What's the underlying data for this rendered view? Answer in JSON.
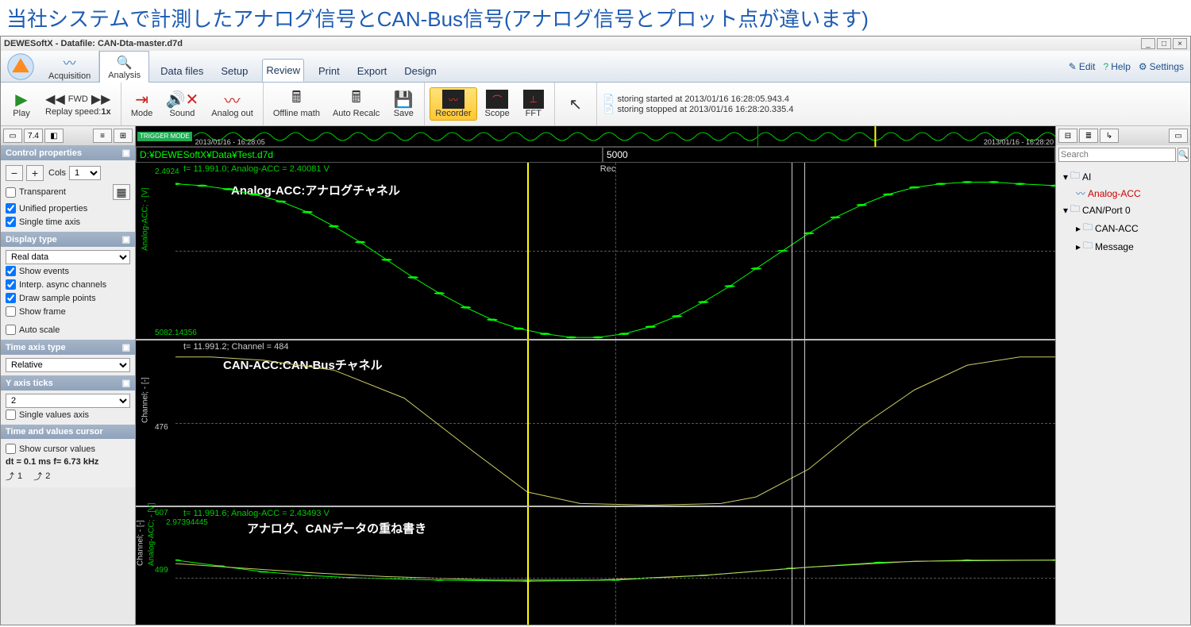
{
  "page_title": "当社システムで計測したアナログ信号とCAN-Bus信号(アナログ信号とプロット点が違います)",
  "titlebar": {
    "text": "DEWESoftX - Datafile: CAN-Dta-master.d7d"
  },
  "modes": {
    "acquisition": "Acquisition",
    "analysis": "Analysis"
  },
  "menu_tabs": [
    "Data files",
    "Setup",
    "Review",
    "Print",
    "Export",
    "Design"
  ],
  "menu_active": "Review",
  "top_links": {
    "edit": "Edit",
    "help": "Help",
    "settings": "Settings"
  },
  "toolbar": {
    "play": "Play",
    "fwd": "FWD",
    "replay": "Replay speed:",
    "replay_val": "1x",
    "mode": "Mode",
    "sound": "Sound",
    "analog_out": "Analog out",
    "offline_math": "Offline math",
    "auto_recalc": "Auto Recalc",
    "save": "Save",
    "recorder": "Recorder",
    "scope": "Scope",
    "fft": "FFT"
  },
  "status": {
    "line1": "storing started at 2013/01/16 16:28:05.943.4",
    "line2": "storing stopped at 2013/01/16 16:28:20.335.4"
  },
  "trigger": {
    "badge": "TRIGGER MODE",
    "t_left": "2013/01/16 - 16:28:05",
    "t_right": "2013/01/16 - 16:28:20"
  },
  "path_row": {
    "path": "D:¥DEWESoftX¥Data¥Test.d7d",
    "value": "5000"
  },
  "left": {
    "control_properties": "Control properties",
    "cols_label": "Cols",
    "cols_value": "1",
    "transparent": "Transparent",
    "unified": "Unified properties",
    "single_time": "Single time axis",
    "display_type": "Display type",
    "display_value": "Real data",
    "show_events": "Show events",
    "interp": "Interp. async channels",
    "draw_points": "Draw sample points",
    "show_frame": "Show frame",
    "auto_scale": "Auto scale",
    "time_axis_type": "Time axis type",
    "time_axis_value": "Relative",
    "y_ticks": "Y axis ticks",
    "y_ticks_value": "2",
    "single_values": "Single values axis",
    "time_cursor": "Time and values cursor",
    "show_cursor": "Show cursor values",
    "dt_line": "dt = 0.1 ms  f= 6.73 kHz",
    "c1": "1",
    "c2": "2"
  },
  "charts": {
    "c1_caption": "t= 11.991.0; Analog-ACC = 2.40081 V",
    "c1_overlay": "Analog-ACC:アナログチャネル",
    "c1_ylab": "Analog-ACC; - [V]",
    "c1_y_top": "2.4924",
    "c1_y_bot": "5082.14356",
    "c2_caption": "t= 11.991.2; Channel = 484",
    "c2_overlay": "CAN-ACC:CAN-Busチャネル",
    "c2_ylab": "Channel; - [-]",
    "c2_y_mid": "476",
    "c3_caption": "t= 11.991.6; Analog-ACC = 2.43493 V",
    "c3_overlay": "アナログ、CANデータの重ね書き",
    "c3_ylab1": "Channel; - [-]",
    "c3_ylab2": "Analog-ACC; - [V]",
    "c3_y_top": "607",
    "c3_y_mid": "499",
    "c3_y_bot": "2.97394445",
    "rec": "Rec"
  },
  "right": {
    "search_ph": "Search",
    "tree": [
      {
        "label": "AI",
        "indent": 0,
        "type": "folder",
        "expand": "▾"
      },
      {
        "label": "Analog-ACC",
        "indent": 1,
        "type": "signal-red"
      },
      {
        "label": "CAN/Port 0",
        "indent": 0,
        "type": "folder",
        "expand": "▾"
      },
      {
        "label": "CAN-ACC",
        "indent": 1,
        "type": "folder",
        "expand": "▸"
      },
      {
        "label": "Message",
        "indent": 1,
        "type": "folder",
        "expand": "▸"
      }
    ]
  },
  "chart_data": [
    {
      "type": "line",
      "name": "Analog-ACC",
      "color": "#0f0",
      "title": "Analog-ACC:アナログチャネル",
      "points": [
        [
          0,
          0.12
        ],
        [
          0.03,
          0.13
        ],
        [
          0.06,
          0.15
        ],
        [
          0.09,
          0.18
        ],
        [
          0.12,
          0.22
        ],
        [
          0.15,
          0.28
        ],
        [
          0.18,
          0.36
        ],
        [
          0.21,
          0.45
        ],
        [
          0.24,
          0.55
        ],
        [
          0.27,
          0.65
        ],
        [
          0.3,
          0.74
        ],
        [
          0.33,
          0.82
        ],
        [
          0.36,
          0.89
        ],
        [
          0.39,
          0.94
        ],
        [
          0.42,
          0.97
        ],
        [
          0.45,
          0.99
        ],
        [
          0.48,
          0.99
        ],
        [
          0.51,
          0.97
        ],
        [
          0.54,
          0.93
        ],
        [
          0.57,
          0.87
        ],
        [
          0.6,
          0.79
        ],
        [
          0.63,
          0.7
        ],
        [
          0.66,
          0.6
        ],
        [
          0.69,
          0.5
        ],
        [
          0.72,
          0.4
        ],
        [
          0.75,
          0.31
        ],
        [
          0.78,
          0.24
        ],
        [
          0.81,
          0.18
        ],
        [
          0.84,
          0.14
        ],
        [
          0.87,
          0.12
        ],
        [
          0.9,
          0.11
        ],
        [
          0.93,
          0.11
        ],
        [
          0.96,
          0.12
        ],
        [
          1.0,
          0.13
        ]
      ],
      "show_markers": true
    },
    {
      "type": "line",
      "name": "CAN-ACC",
      "color": "#cccc66",
      "title": "CAN-ACC:CAN-Busチャネル",
      "points": [
        [
          0,
          0.1
        ],
        [
          0.04,
          0.1
        ],
        [
          0.1,
          0.12
        ],
        [
          0.18,
          0.18
        ],
        [
          0.26,
          0.35
        ],
        [
          0.34,
          0.68
        ],
        [
          0.4,
          0.92
        ],
        [
          0.46,
          0.99
        ],
        [
          0.54,
          1.0
        ],
        [
          0.62,
          0.99
        ],
        [
          0.66,
          0.95
        ],
        [
          0.72,
          0.78
        ],
        [
          0.78,
          0.52
        ],
        [
          0.84,
          0.3
        ],
        [
          0.9,
          0.15
        ],
        [
          0.96,
          0.1
        ],
        [
          1.0,
          0.1
        ]
      ],
      "show_markers": false
    },
    {
      "type": "line",
      "name": "Overlay",
      "title": "アナログ、CANデータの重ね書き",
      "series": [
        {
          "name": "Analog-ACC",
          "color": "#0f0",
          "points": [
            [
              0,
              0.45
            ],
            [
              0.05,
              0.5
            ],
            [
              0.1,
              0.55
            ],
            [
              0.15,
              0.58
            ],
            [
              0.2,
              0.6
            ],
            [
              0.3,
              0.62
            ],
            [
              0.4,
              0.63
            ],
            [
              0.5,
              0.62
            ],
            [
              0.6,
              0.58
            ],
            [
              0.7,
              0.52
            ],
            [
              0.8,
              0.47
            ],
            [
              0.9,
              0.45
            ],
            [
              1.0,
              0.45
            ]
          ],
          "show_markers": true
        },
        {
          "name": "CAN-ACC",
          "color": "#cccc66",
          "points": [
            [
              0,
              0.48
            ],
            [
              0.08,
              0.52
            ],
            [
              0.16,
              0.56
            ],
            [
              0.24,
              0.59
            ],
            [
              0.36,
              0.62
            ],
            [
              0.48,
              0.62
            ],
            [
              0.6,
              0.58
            ],
            [
              0.72,
              0.51
            ],
            [
              0.84,
              0.46
            ],
            [
              1.0,
              0.45
            ]
          ],
          "show_markers": false
        }
      ]
    }
  ]
}
